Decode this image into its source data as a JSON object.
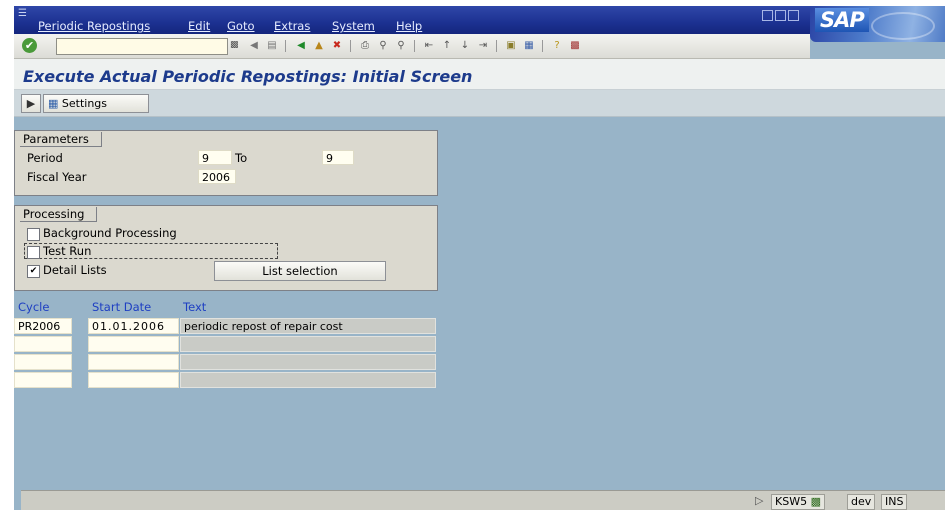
{
  "menu": [
    "Periodic Repostings",
    "Edit",
    "Goto",
    "Extras",
    "System",
    "Help"
  ],
  "brand": "SAP",
  "toolbar": {
    "command_field_value": "",
    "icons": [
      "check-icon",
      "back-icon",
      "save-icon",
      "green-back-icon",
      "exit-icon",
      "cancel-icon",
      "print-icon",
      "find-icon",
      "find-next-icon",
      "first-page-icon",
      "previous-page-icon",
      "next-page-icon",
      "last-page-icon",
      "create-session-icon",
      "shortcut-icon",
      "help-icon",
      "layout-icon"
    ]
  },
  "title": "Execute Actual Periodic Repostings: Initial Screen",
  "app_toolbar": {
    "settings_label": "Settings",
    "execute_icon": "execute-icon",
    "settings_icon": "settings-icon"
  },
  "parameters": {
    "group_label": "Parameters",
    "period_label": "Period",
    "period_from": "9",
    "to_label": "To",
    "period_to": "9",
    "fiscal_year_label": "Fiscal Year",
    "fiscal_year": "2006"
  },
  "processing": {
    "group_label": "Processing",
    "background_label": "Background Processing",
    "background_checked": false,
    "test_run_label": "Test Run",
    "test_run_checked": false,
    "detail_lists_label": "Detail Lists",
    "detail_lists_checked": true,
    "list_selection_label": "List selection"
  },
  "table": {
    "headers": [
      "Cycle",
      "Start Date",
      "Text"
    ],
    "rows": [
      [
        "PR2006",
        "01.01.2006",
        "periodic repost of repair cost"
      ],
      [
        "",
        "",
        ""
      ],
      [
        "",
        "",
        ""
      ],
      [
        "",
        "",
        ""
      ]
    ]
  },
  "status": {
    "transaction": "KSW5",
    "system": "dev",
    "mode": "INS"
  },
  "colors": {
    "menu_bar": "#1c3191",
    "background": "#98b4c8",
    "title_text": "#1d3b8c",
    "header_text": "#1e3fc2"
  }
}
